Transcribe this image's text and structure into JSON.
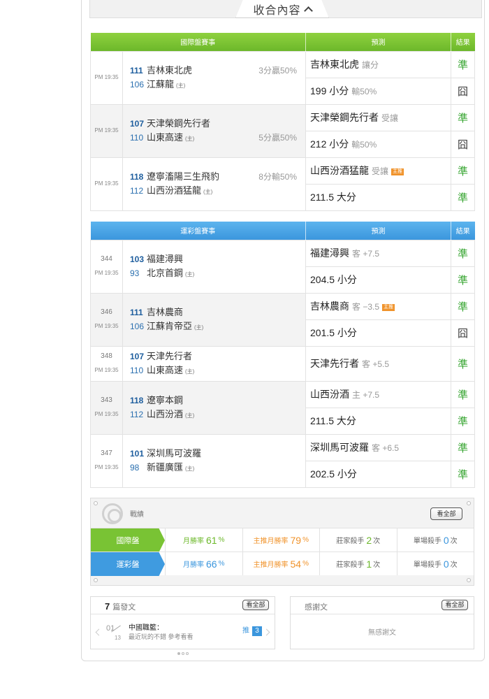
{
  "collapse": {
    "label": "收合內容"
  },
  "intl": {
    "headers": {
      "games": "國際盤賽事",
      "predict": "預測",
      "result": "結果"
    },
    "games": [
      {
        "time": "PM 19:35",
        "away_num": "111",
        "away": "吉林東北虎",
        "home_num": "106",
        "home": "江蘇龍",
        "home_mark": "(主)",
        "spread": "3分贏50%",
        "spread_row": "away",
        "preds": [
          {
            "main": "吉林東北虎",
            "sub": "讓分",
            "tag": "",
            "result": "準",
            "win": true
          },
          {
            "main": "199 小分",
            "sub": "輸50%",
            "tag": "",
            "result": "囧",
            "win": false
          }
        ]
      },
      {
        "time": "PM 19:35",
        "away_num": "107",
        "away": "天津榮鋼先行者",
        "home_num": "110",
        "home": "山東高速",
        "home_mark": "(主)",
        "spread": "5分贏50%",
        "spread_row": "home",
        "preds": [
          {
            "main": "天津榮鋼先行者",
            "sub": "受讓",
            "tag": "",
            "result": "準",
            "win": true
          },
          {
            "main": "212 小分",
            "sub": "輸50%",
            "tag": "",
            "result": "囧",
            "win": false
          }
        ]
      },
      {
        "time": "PM 19:35",
        "away_num": "118",
        "away": "遼寧滀陽三生飛豹",
        "home_num": "112",
        "home": "山西汾酒猛龍",
        "home_mark": "(主)",
        "spread": "8分輸50%",
        "spread_row": "away",
        "preds": [
          {
            "main": "山西汾酒猛龍",
            "sub": "受讓",
            "tag": "主推",
            "result": "準",
            "win": true
          },
          {
            "main": "211.5 大分",
            "sub": "",
            "tag": "",
            "result": "準",
            "win": true
          }
        ]
      }
    ]
  },
  "lottery": {
    "headers": {
      "games": "運彩盤賽事",
      "predict": "預測",
      "result": "結果"
    },
    "games": [
      {
        "code": "344",
        "time": "PM 19:35",
        "away_num": "103",
        "away": "福建潯興",
        "home_num": "93",
        "home": "北京首鋼",
        "home_mark": "(主)",
        "preds": [
          {
            "main": "福建潯興",
            "sub": "客 +7.5",
            "tag": "",
            "result": "準",
            "win": true
          },
          {
            "main": "204.5 小分",
            "sub": "",
            "tag": "",
            "result": "準",
            "win": true
          }
        ]
      },
      {
        "code": "346",
        "time": "PM 19:35",
        "away_num": "111",
        "away": "吉林農商",
        "home_num": "106",
        "home": "江蘇肯帝亞",
        "home_mark": "(主)",
        "preds": [
          {
            "main": "吉林農商",
            "sub": "客 −3.5",
            "tag": "主推",
            "result": "準",
            "win": true
          },
          {
            "main": "201.5 小分",
            "sub": "",
            "tag": "",
            "result": "囧",
            "win": false
          }
        ]
      },
      {
        "code": "348",
        "time": "PM 19:35",
        "away_num": "107",
        "away": "天津先行者",
        "home_num": "110",
        "home": "山東高速",
        "home_mark": "(主)",
        "preds": [
          {
            "main": "天津先行者",
            "sub": "客 +5.5",
            "tag": "",
            "result": "準",
            "win": true
          }
        ]
      },
      {
        "code": "343",
        "time": "PM 19:35",
        "away_num": "118",
        "away": "遼寧本鋼",
        "home_num": "112",
        "home": "山西汾酒",
        "home_mark": "(主)",
        "preds": [
          {
            "main": "山西汾酒",
            "sub": "主 +7.5",
            "tag": "",
            "result": "準",
            "win": true
          },
          {
            "main": "211.5 大分",
            "sub": "",
            "tag": "",
            "result": "準",
            "win": true
          }
        ]
      },
      {
        "code": "347",
        "time": "PM 19:35",
        "away_num": "101",
        "away": "深圳馬可波羅",
        "home_num": "98",
        "home": "新疆廣匯",
        "home_mark": "(主)",
        "preds": [
          {
            "main": "深圳馬可波羅",
            "sub": "客 +6.5",
            "tag": "",
            "result": "準",
            "win": true
          },
          {
            "main": "202.5 小分",
            "sub": "",
            "tag": "",
            "result": "準",
            "win": true
          }
        ]
      }
    ]
  },
  "record": {
    "title": "戰績",
    "view_all": "看全部",
    "rows": [
      {
        "label": "國際盤",
        "monthly_label": "月勝率",
        "monthly": "61",
        "main_label": "主推月勝率",
        "main": "79",
        "pct": "%",
        "dealer_label": "莊家殺手",
        "dealer": "2",
        "single_label": "單場殺手",
        "single": "0",
        "times": "次"
      },
      {
        "label": "運彩盤",
        "monthly_label": "月勝率",
        "monthly": "66",
        "main_label": "主推月勝率",
        "main": "54",
        "pct": "%",
        "dealer_label": "莊家殺手",
        "dealer": "1",
        "single_label": "單場殺手",
        "single": "0",
        "times": "次"
      }
    ]
  },
  "posts": {
    "count": "7",
    "title": "篇發文",
    "view_all": "看全部",
    "item": {
      "month": "01",
      "day": "13",
      "title": "中國職籃：",
      "excerpt": "最近玩的不錯 參考看看",
      "push_label": "推",
      "push_count": "3"
    }
  },
  "thanks": {
    "title": "感謝文",
    "view_all": "看全部",
    "empty": "無感謝文"
  }
}
